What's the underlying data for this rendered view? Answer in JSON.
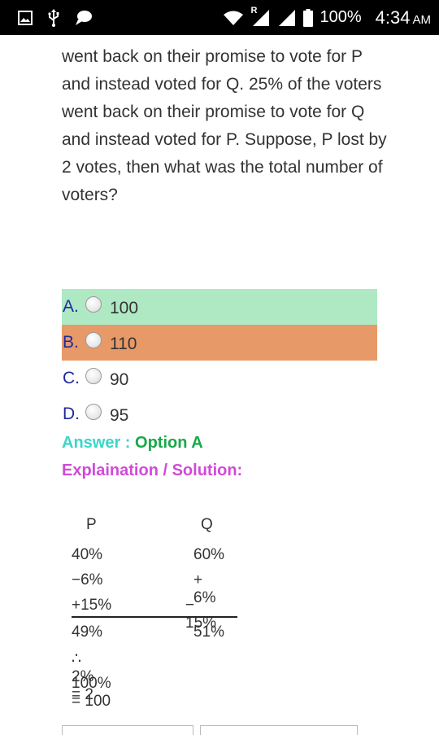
{
  "status_bar": {
    "icons": [
      "gallery-icon",
      "usb-icon",
      "chat-icon",
      "wifi-icon",
      "signal-r-icon",
      "signal-icon",
      "battery-icon"
    ],
    "roaming_marker": "R",
    "battery": "100%",
    "time": "4:34",
    "ampm": "AM"
  },
  "question_text": "went back on their promise to vote for P and instead voted for Q. 25% of the voters went back on their promise to vote for Q and instead voted for P. Suppose, P lost by 2 votes, then what was the total number of voters?",
  "options": [
    {
      "letter": "A.",
      "text": "100",
      "highlight": "correct",
      "color": "#aee9c4"
    },
    {
      "letter": "B.",
      "text": "110",
      "highlight": "wrong",
      "color": "#e89968"
    },
    {
      "letter": "C.",
      "text": "90",
      "highlight": "none"
    },
    {
      "letter": "D.",
      "text": "95",
      "highlight": "none"
    }
  ],
  "answer": {
    "label": "Answer : ",
    "value": "Option A"
  },
  "explanation_title": "Explaination / Solution:",
  "solution": {
    "col_p": {
      "header": "P",
      "rows": [
        "40%",
        "−6%",
        "+15%",
        "49%"
      ]
    },
    "col_q": {
      "header": "Q",
      "rows": [
        "60%",
        "+ 6%",
        "− 15%",
        "51%"
      ]
    },
    "step1": "∴ 2% = 2",
    "step2": "100% = 100"
  },
  "colors": {
    "option_letter": "#1f2a9c",
    "answer_label": "#3ad6c9",
    "answer_value": "#18a84a",
    "explanation": "#d14ad8"
  }
}
